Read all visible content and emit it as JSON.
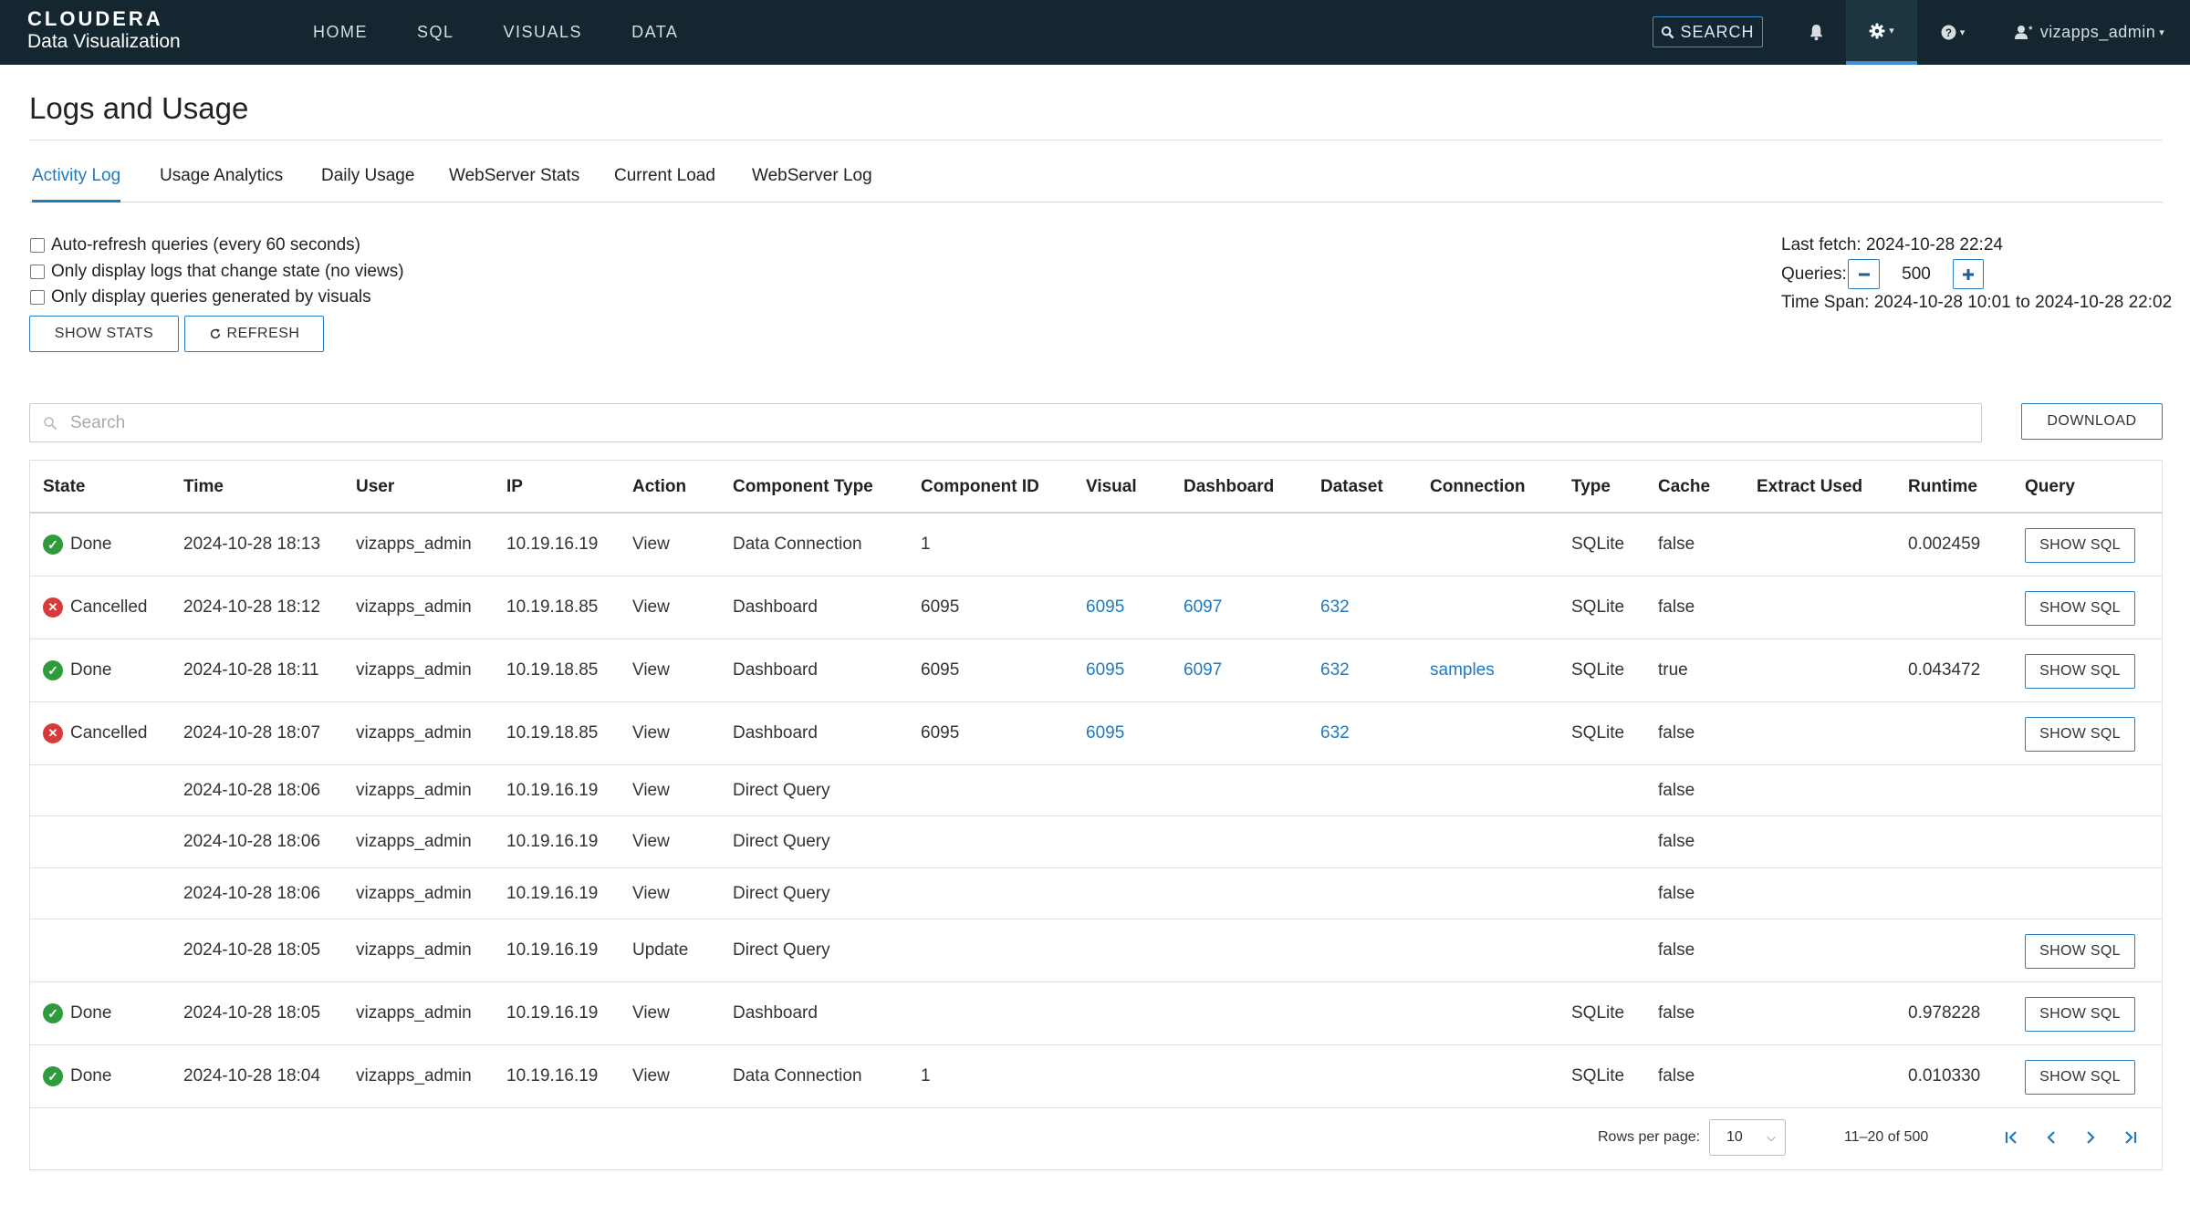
{
  "navbar": {
    "brand_top": "CLOUDERA",
    "brand_sub": "Data Visualization",
    "links": [
      "HOME",
      "SQL",
      "VISUALS",
      "DATA"
    ],
    "search_label": "SEARCH",
    "user": "vizapps_admin"
  },
  "page": {
    "title": "Logs and Usage",
    "tabs": [
      "Activity Log",
      "Usage Analytics",
      "Daily Usage",
      "WebServer Stats",
      "Current Load",
      "WebServer Log"
    ],
    "active_tab": "Activity Log"
  },
  "options": {
    "auto_refresh": "Auto-refresh queries (every 60 seconds)",
    "change_state": "Only display logs that change state (no views)",
    "by_visuals": "Only display queries generated by visuals",
    "show_stats": "SHOW STATS",
    "refresh": "REFRESH"
  },
  "fetch": {
    "last_fetch": "Last fetch: 2024-10-28 22:24",
    "queries_label": "Queries:",
    "queries_value": "500",
    "time_span": "Time Span: 2024-10-28 10:01 to 2024-10-28 22:02"
  },
  "search": {
    "placeholder": "Search",
    "download": "DOWNLOAD"
  },
  "table": {
    "headers": [
      "State",
      "Time",
      "User",
      "IP",
      "Action",
      "Component Type",
      "Component ID",
      "Visual",
      "Dashboard",
      "Dataset",
      "Connection",
      "Type",
      "Cache",
      "Extract Used",
      "Runtime",
      "Query"
    ],
    "sql_label": "SHOW SQL",
    "rows": [
      {
        "state": "Done",
        "time": "2024-10-28 18:13",
        "user": "vizapps_admin",
        "ip": "10.19.16.19",
        "action": "View",
        "ctype": "Data Connection",
        "cid": "1",
        "visual": "",
        "dashboard": "",
        "dataset": "",
        "connection": "",
        "type": "SQLite",
        "cache": "false",
        "extract": "",
        "runtime": "0.002459",
        "sql": true
      },
      {
        "state": "Cancelled",
        "time": "2024-10-28 18:12",
        "user": "vizapps_admin",
        "ip": "10.19.18.85",
        "action": "View",
        "ctype": "Dashboard",
        "cid": "6095",
        "visual": "6095",
        "dashboard": "6097",
        "dataset": "632",
        "connection": "",
        "type": "SQLite",
        "cache": "false",
        "extract": "",
        "runtime": "",
        "sql": true
      },
      {
        "state": "Done",
        "time": "2024-10-28 18:11",
        "user": "vizapps_admin",
        "ip": "10.19.18.85",
        "action": "View",
        "ctype": "Dashboard",
        "cid": "6095",
        "visual": "6095",
        "dashboard": "6097",
        "dataset": "632",
        "connection": "samples",
        "type": "SQLite",
        "cache": "true",
        "extract": "",
        "runtime": "0.043472",
        "sql": true
      },
      {
        "state": "Cancelled",
        "time": "2024-10-28 18:07",
        "user": "vizapps_admin",
        "ip": "10.19.18.85",
        "action": "View",
        "ctype": "Dashboard",
        "cid": "6095",
        "visual": "6095",
        "dashboard": "",
        "dataset": "632",
        "connection": "",
        "type": "SQLite",
        "cache": "false",
        "extract": "",
        "runtime": "",
        "sql": true
      },
      {
        "state": "",
        "time": "2024-10-28 18:06",
        "user": "vizapps_admin",
        "ip": "10.19.16.19",
        "action": "View",
        "ctype": "Direct Query",
        "cid": "",
        "visual": "",
        "dashboard": "",
        "dataset": "",
        "connection": "",
        "type": "",
        "cache": "false",
        "extract": "",
        "runtime": "",
        "sql": false
      },
      {
        "state": "",
        "time": "2024-10-28 18:06",
        "user": "vizapps_admin",
        "ip": "10.19.16.19",
        "action": "View",
        "ctype": "Direct Query",
        "cid": "",
        "visual": "",
        "dashboard": "",
        "dataset": "",
        "connection": "",
        "type": "",
        "cache": "false",
        "extract": "",
        "runtime": "",
        "sql": false
      },
      {
        "state": "",
        "time": "2024-10-28 18:06",
        "user": "vizapps_admin",
        "ip": "10.19.16.19",
        "action": "View",
        "ctype": "Direct Query",
        "cid": "",
        "visual": "",
        "dashboard": "",
        "dataset": "",
        "connection": "",
        "type": "",
        "cache": "false",
        "extract": "",
        "runtime": "",
        "sql": false
      },
      {
        "state": "",
        "time": "2024-10-28 18:05",
        "user": "vizapps_admin",
        "ip": "10.19.16.19",
        "action": "Update",
        "ctype": "Direct Query",
        "cid": "",
        "visual": "",
        "dashboard": "",
        "dataset": "",
        "connection": "",
        "type": "",
        "cache": "false",
        "extract": "",
        "runtime": "",
        "sql": true
      },
      {
        "state": "Done",
        "time": "2024-10-28 18:05",
        "user": "vizapps_admin",
        "ip": "10.19.16.19",
        "action": "View",
        "ctype": "Dashboard",
        "cid": "",
        "visual": "",
        "dashboard": "",
        "dataset": "",
        "connection": "",
        "type": "SQLite",
        "cache": "false",
        "extract": "",
        "runtime": "0.978228",
        "sql": true
      },
      {
        "state": "Done",
        "time": "2024-10-28 18:04",
        "user": "vizapps_admin",
        "ip": "10.19.16.19",
        "action": "View",
        "ctype": "Data Connection",
        "cid": "1",
        "visual": "",
        "dashboard": "",
        "dataset": "",
        "connection": "",
        "type": "SQLite",
        "cache": "false",
        "extract": "",
        "runtime": "0.010330",
        "sql": true
      }
    ]
  },
  "pagination": {
    "rows_per_page_label": "Rows per page:",
    "rows_per_page": "10",
    "range": "11–20 of 500"
  },
  "colors": {
    "navbar_bg": "#142730",
    "accent": "#1f7ac0",
    "done": "#2f9b3c",
    "cancelled": "#d83a3a"
  }
}
